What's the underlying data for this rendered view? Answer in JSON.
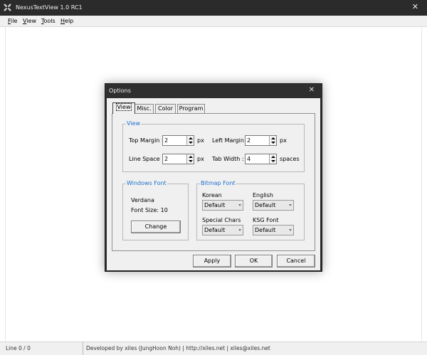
{
  "window": {
    "title": "NexusTextView 1.0 RC1",
    "close_glyph": "✕"
  },
  "menu": [
    "File",
    "View",
    "Tools",
    "Help"
  ],
  "status": {
    "position": "Line 0 / 0",
    "credits": "Developed by xiles (JungHoon Noh)  |  http://xiles.net  |  xiles@xiles.net"
  },
  "dialog": {
    "title": "Options",
    "close_glyph": "✕",
    "tabs": [
      "View",
      "Misc.",
      "Color",
      "Program"
    ],
    "active_tab": "View",
    "view_group": {
      "legend": "View",
      "top_margin": {
        "label": "Top Margin :",
        "value": "2",
        "unit": "px"
      },
      "left_margin": {
        "label": "Left Margin :",
        "value": "2",
        "unit": "px"
      },
      "line_space": {
        "label": "Line Space :",
        "value": "2",
        "unit": "px"
      },
      "tab_width": {
        "label": "Tab Width :",
        "value": "4",
        "unit": "spaces"
      }
    },
    "windows_font": {
      "legend": "Windows Font",
      "font_name": "Verdana",
      "font_size": "Font Size: 10",
      "change_label": "Change"
    },
    "bitmap_font": {
      "legend": "Bitmap Font",
      "korean": {
        "label": "Korean",
        "value": "Default"
      },
      "english": {
        "label": "English",
        "value": "Default"
      },
      "special": {
        "label": "Special Chars",
        "value": "Default"
      },
      "ksg": {
        "label": "KSG Font",
        "value": "Default"
      }
    },
    "buttons": {
      "apply": "Apply",
      "ok": "OK",
      "cancel": "Cancel"
    }
  },
  "colors": {
    "titlebar": "#2b2b2b",
    "legend_blue": "#1c6fcf",
    "dialog_face": "#f0f0f0"
  },
  "icons": {
    "app": "app-logo-icon",
    "close": "close-icon",
    "spin_up": "triangle-up-icon",
    "spin_down": "triangle-down-icon",
    "dropdown": "chevron-down-icon"
  }
}
